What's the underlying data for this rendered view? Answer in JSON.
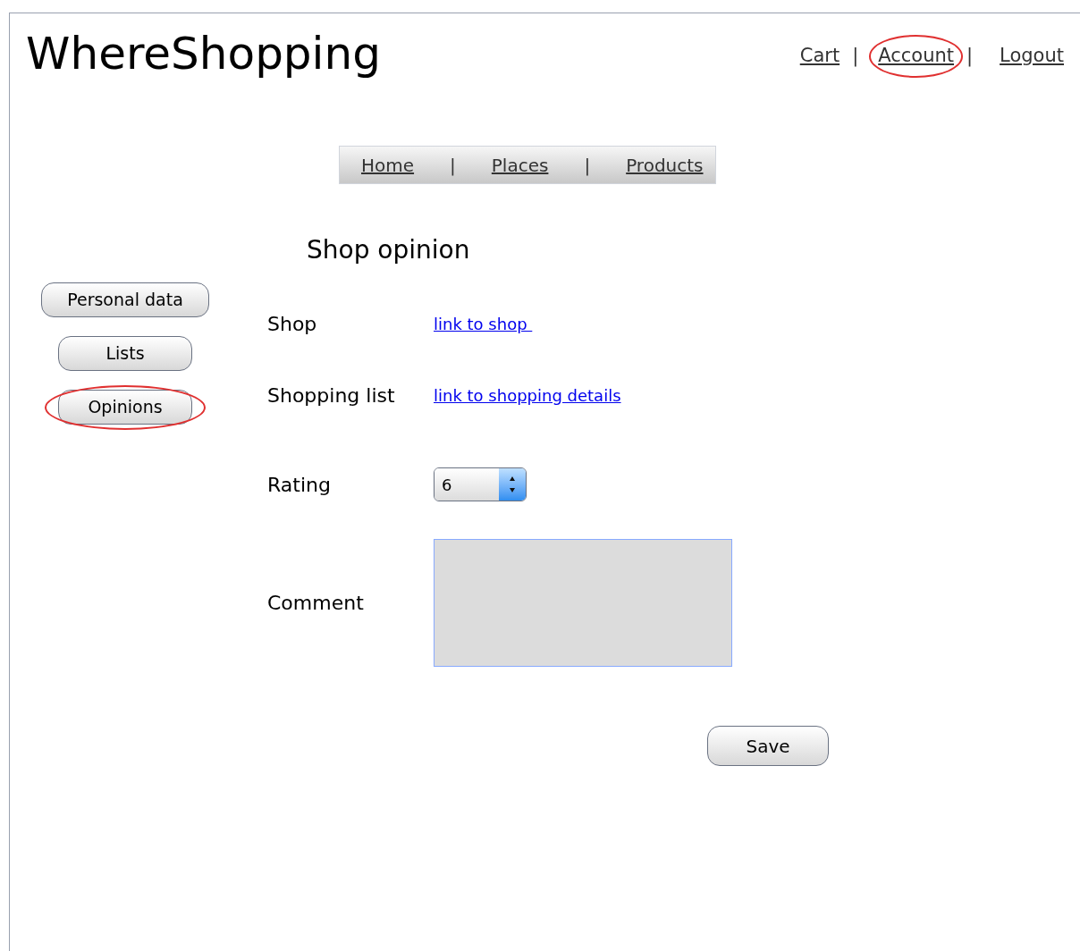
{
  "title": "WhereShopping",
  "top_links": [
    {
      "label": "Cart",
      "selected": false
    },
    {
      "label": "Account",
      "selected": true
    },
    {
      "label": "Logout",
      "selected": false
    }
  ],
  "top_separators": [
    "|",
    "|"
  ],
  "nav": [
    "Home",
    "Places",
    "Products"
  ],
  "nav_separators": [
    "|",
    "|"
  ],
  "sidebar": [
    {
      "label": "Personal data",
      "selected": false
    },
    {
      "label": "Lists",
      "selected": false
    },
    {
      "label": "Opinions",
      "selected": true
    }
  ],
  "heading": "Shop opinion",
  "fields": [
    {
      "kind": "link",
      "label": "Shop",
      "value": "link to shop "
    },
    {
      "kind": "link",
      "label": "Shopping list",
      "value": "link to shopping details"
    },
    {
      "kind": "select",
      "label": "Rating",
      "value": "6"
    },
    {
      "kind": "textarea",
      "label": "Comment"
    }
  ],
  "save": "Save"
}
